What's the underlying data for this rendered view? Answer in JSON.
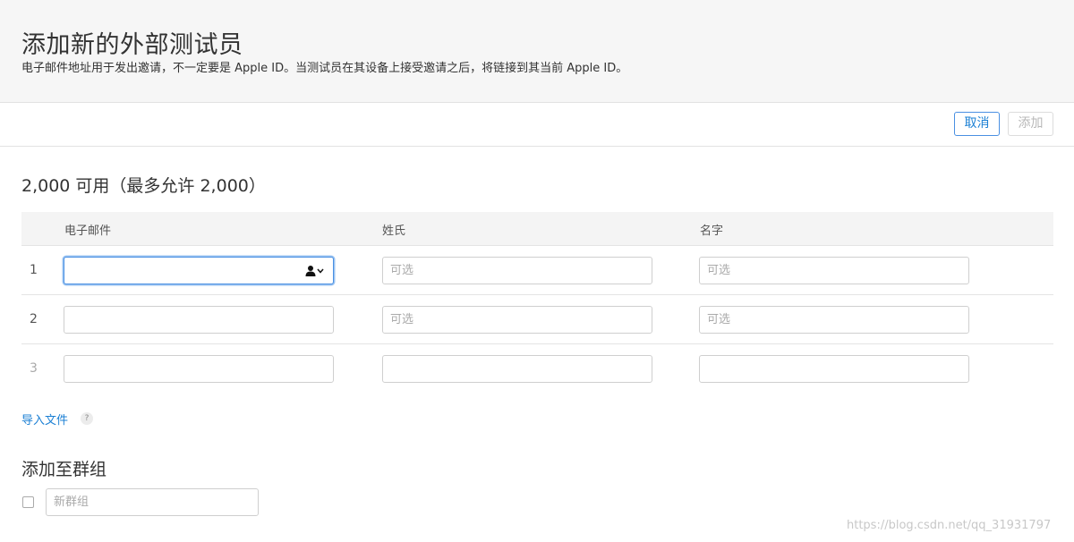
{
  "header": {
    "title": "添加新的外部测试员",
    "subtitle": "电子邮件地址用于发出邀请，不一定要是 Apple ID。当测试员在其设备上接受邀请之后，将链接到其当前 Apple ID。"
  },
  "toolbar": {
    "cancel_label": "取消",
    "add_label": "添加"
  },
  "availability": "2,000 可用（最多允许 2,000）",
  "table": {
    "columns": [
      "电子邮件",
      "姓氏",
      "名字"
    ],
    "rows": [
      {
        "number": "1",
        "email_value": "",
        "last_placeholder": "可选",
        "first_placeholder": "可选"
      },
      {
        "number": "2",
        "email_value": "",
        "last_placeholder": "可选",
        "first_placeholder": "可选"
      },
      {
        "number": "3",
        "email_value": "",
        "last_placeholder": "",
        "first_placeholder": ""
      }
    ]
  },
  "import_link": "导入文件",
  "help_glyph": "?",
  "group": {
    "title": "添加至群组",
    "input_placeholder": "新群组",
    "checked": false
  },
  "watermark": "https://blog.csdn.net/qq_31931797",
  "icons": {
    "contacts": "contact-person-icon",
    "dropdown": "chevron-down-icon",
    "help": "question-icon"
  },
  "colors": {
    "accent": "#1a7fd4",
    "focus_border": "#4a90e2",
    "header_bg": "#f6f6f6"
  }
}
